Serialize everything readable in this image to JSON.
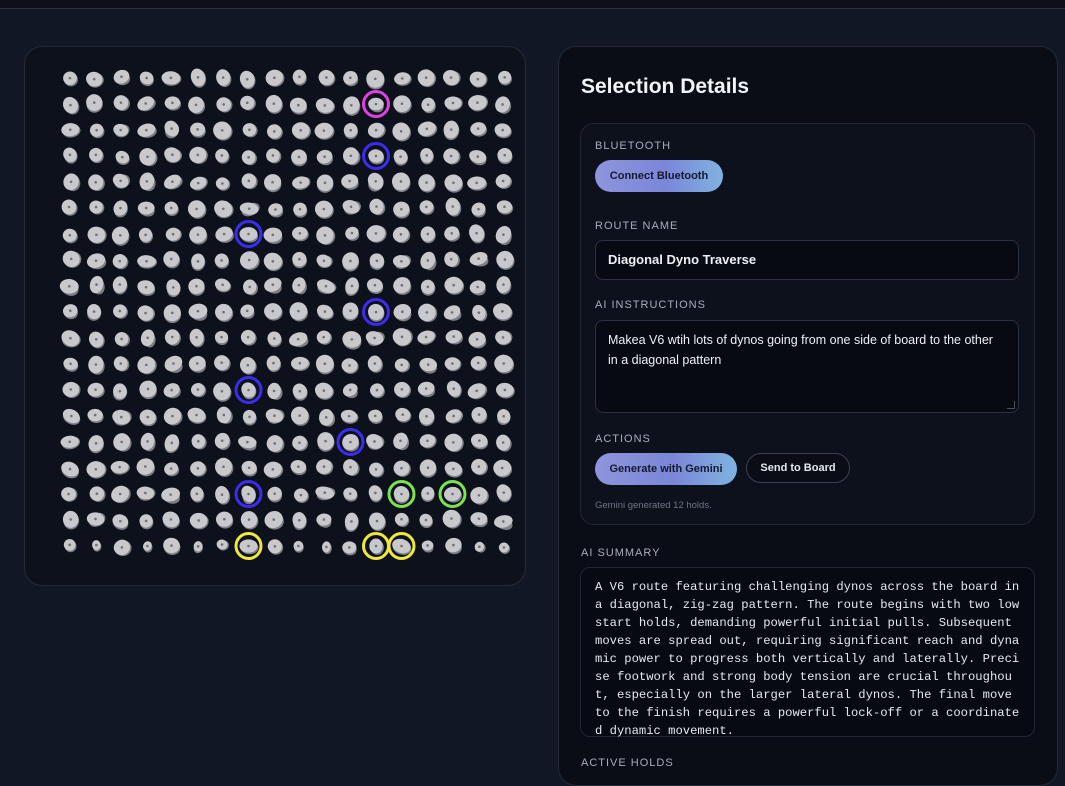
{
  "details": {
    "title": "Selection Details",
    "bluetooth_label": "BLUETOOTH",
    "connect_button": "Connect Bluetooth",
    "route_name_label": "ROUTE NAME",
    "route_name_value": "Diagonal Dyno Traverse",
    "ai_instructions_label": "AI INSTRUCTIONS",
    "ai_instructions_value": "Makea V6 wtih lots of dynos going from one side of board to the other in a diagonal pattern",
    "actions_label": "ACTIONS",
    "generate_button": "Generate with Gemini",
    "send_button": "Send to Board",
    "status_text": "Gemini generated 12 holds.",
    "ai_summary_label": "AI SUMMARY",
    "ai_summary_text": "A V6 route featuring challenging dynos across the board in a diagonal, zig-zag pattern. The route begins with two low start holds, demanding powerful initial pulls. Subsequent moves are spread out, requiring significant reach and dynamic power to progress both vertically and laterally. Precise footwork and strong body tension are crucial throughout, especially on the larger lateral dynos. The final move to the finish requires a powerful lock-off or a coordinated dynamic movement.",
    "active_holds_label": "ACTIVE HOLDS"
  },
  "board": {
    "colors": {
      "hold": "#c9c9cd",
      "hold_shadow": "#7d7f86",
      "finish": "#e040e0",
      "hand": "#3a2cf0",
      "foot": "#7be34e",
      "start": "#f0e83a"
    },
    "selected_holds": [
      {
        "role": "finish",
        "row": 1,
        "col": 12
      },
      {
        "role": "hand",
        "row": 3,
        "col": 12
      },
      {
        "role": "hand",
        "row": 6,
        "col": 7
      },
      {
        "role": "hand",
        "row": 9,
        "col": 12
      },
      {
        "role": "hand",
        "row": 12,
        "col": 7
      },
      {
        "role": "hand",
        "row": 14,
        "col": 11
      },
      {
        "role": "hand",
        "row": 16,
        "col": 7
      },
      {
        "role": "foot",
        "row": 16,
        "col": 13
      },
      {
        "role": "foot",
        "row": 16,
        "col": 15
      },
      {
        "role": "start",
        "row": 18,
        "col": 7
      },
      {
        "role": "start",
        "row": 18,
        "col": 12
      },
      {
        "role": "start",
        "row": 18,
        "col": 13
      }
    ]
  }
}
